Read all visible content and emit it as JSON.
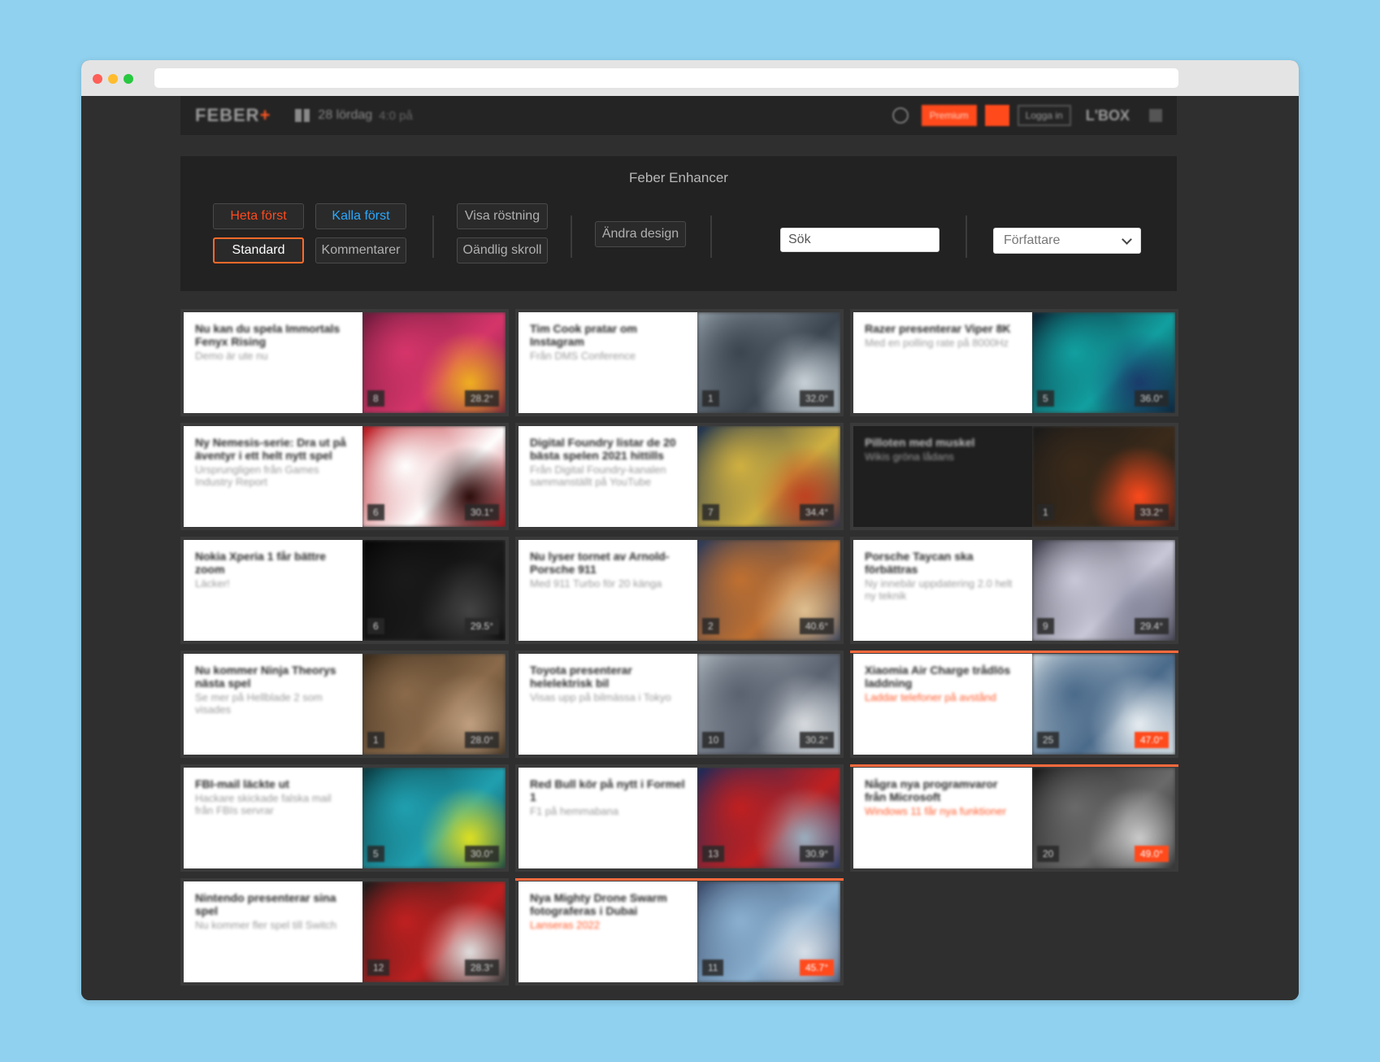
{
  "site_header": {
    "logo": "FEBER",
    "logo_plus": "+",
    "date": "28 lördag",
    "time": "4:0 på",
    "btn_primary": "Premium",
    "btn_login": "Logga in",
    "user": "L'BOX"
  },
  "enhancer": {
    "title": "Feber Enhancer",
    "buttons": {
      "hot_first": "Heta först",
      "cold_first": "Kalla först",
      "standard": "Standard",
      "comments": "Kommentarer",
      "show_votes": "Visa röstning",
      "infinite_scroll": "Oändlig skroll",
      "change_design": "Ändra design"
    },
    "search_placeholder": "Sök",
    "author_select": "Författare"
  },
  "articles": [
    {
      "title": "Nu kan du spela Immortals Fenyx Rising",
      "sub": "Demo är ute nu",
      "count": "8",
      "temp": "28.2°",
      "image": "fantasy-art",
      "colors": [
        "#6a1a3a",
        "#d6356a",
        "#f0b020"
      ]
    },
    {
      "title": "Tim Cook pratar om Instagram",
      "sub": "Från DMS Conference",
      "count": "1",
      "temp": "32.0°",
      "image": "man-in-suit",
      "colors": [
        "#8d99a3",
        "#3b4550",
        "#c9d2d8"
      ]
    },
    {
      "title": "Razer presenterar Viper 8K",
      "sub": "Med en polling rate på 8000Hz",
      "count": "5",
      "temp": "36.0°",
      "image": "keyboard",
      "colors": [
        "#0a2030",
        "#12a0a0",
        "#1a3a6a"
      ]
    },
    {
      "title": "Ny Nemesis-serie: Dra ut på äventyr i ett helt nytt spel",
      "sub": "Ursprungligen från Games Industry Report",
      "count": "6",
      "temp": "30.1°",
      "image": "nemesis-poster",
      "colors": [
        "#b8121a",
        "#ffffff",
        "#2a0a0a"
      ]
    },
    {
      "title": "Digital Foundry listar de 20 bästa spelen 2021 hittills",
      "sub": "Från Digital Foundry-kanalen sammanställt på YouTube",
      "count": "7",
      "temp": "34.4°",
      "image": "game-poster",
      "colors": [
        "#1a3050",
        "#d0b040",
        "#c04020"
      ]
    },
    {
      "title": "Pilloten med muskel",
      "sub": "Wikis gröna lådans",
      "count": "1",
      "temp": "33.2°",
      "image": "rubiks-hands",
      "colors": [
        "#1a1a1a",
        "#3a2a1a",
        "#ff4a1c"
      ],
      "dark": true
    },
    {
      "title": "Nokia Xperia 1 får bättre zoom",
      "sub": "Läcker!",
      "count": "6",
      "temp": "29.5°",
      "image": "phone",
      "colors": [
        "#050505",
        "#1a1a1a",
        "#444444"
      ]
    },
    {
      "title": "Nu lyser tornet av Arnold-Porsche 911",
      "sub": "Med 911 Turbo för 20 känga",
      "count": "2",
      "temp": "40.6°",
      "image": "exhibition",
      "colors": [
        "#2a3a5a",
        "#c07030",
        "#e0c090"
      ]
    },
    {
      "title": "Porsche Taycan ska förbättras",
      "sub": "Ny innebär uppdatering 2.0 helt ny teknik",
      "count": "9",
      "temp": "29.4°",
      "image": "silver-car",
      "colors": [
        "#3a3a48",
        "#c8c8d8",
        "#8a8aa0"
      ]
    },
    {
      "title": "Nu kommer Ninja Theorys nästa spel",
      "sub": "Se mer på Hellblade 2 som visades",
      "count": "1",
      "temp": "28.0°",
      "image": "battle-art",
      "colors": [
        "#3a2a1a",
        "#8a6a4a",
        "#c0a080"
      ]
    },
    {
      "title": "Toyota presenterar helelektrisk bil",
      "sub": "Visas upp på bilmässa i Tokyo",
      "count": "10",
      "temp": "30.2°",
      "image": "city-car",
      "colors": [
        "#a8b0b8",
        "#5a6270",
        "#d8dce0"
      ]
    },
    {
      "title": "Xiaomia Air Charge trådlös laddning",
      "sub": "Laddar telefoner på avstånd",
      "count": "25",
      "temp": "47.0°",
      "image": "charger",
      "colors": [
        "#c8d4dc",
        "#4a6a8a",
        "#e8eef2"
      ],
      "hot": true
    },
    {
      "title": "FBI-mail läckte ut",
      "sub": "Hackare skickade falska mail från FBIs servrar",
      "count": "5",
      "temp": "30.0°",
      "image": "fan-art",
      "colors": [
        "#0a3a40",
        "#20a0b0",
        "#e0e020"
      ]
    },
    {
      "title": "Red Bull kör på nytt i Formel 1",
      "sub": "F1 på hemmabana",
      "count": "13",
      "temp": "30.9°",
      "image": "f1-car",
      "colors": [
        "#1a2a5a",
        "#c02020",
        "#9ab0c0"
      ]
    },
    {
      "title": "Några nya programvaror från Microsoft",
      "sub": "Windows 11 får nya funktioner",
      "count": "20",
      "temp": "49.0°",
      "image": "grid-photo",
      "colors": [
        "#1a1a1a",
        "#6a6a6a",
        "#cccccc"
      ],
      "hot": true
    },
    {
      "title": "Nintendo presenterar sina spel",
      "sub": "Nu kommer fler spel till Switch",
      "count": "12",
      "temp": "28.3°",
      "image": "poster-text",
      "colors": [
        "#1a1a1a",
        "#c02020",
        "#e0e0e0"
      ]
    },
    {
      "title": "Nya Mighty Drone Swarm fotograferas i Dubai",
      "sub": "Lanseras 2022",
      "count": "11",
      "temp": "45.7°",
      "image": "stadium",
      "colors": [
        "#3a4a6a",
        "#8ab0d0",
        "#d8e0e8"
      ],
      "hot": true
    }
  ]
}
